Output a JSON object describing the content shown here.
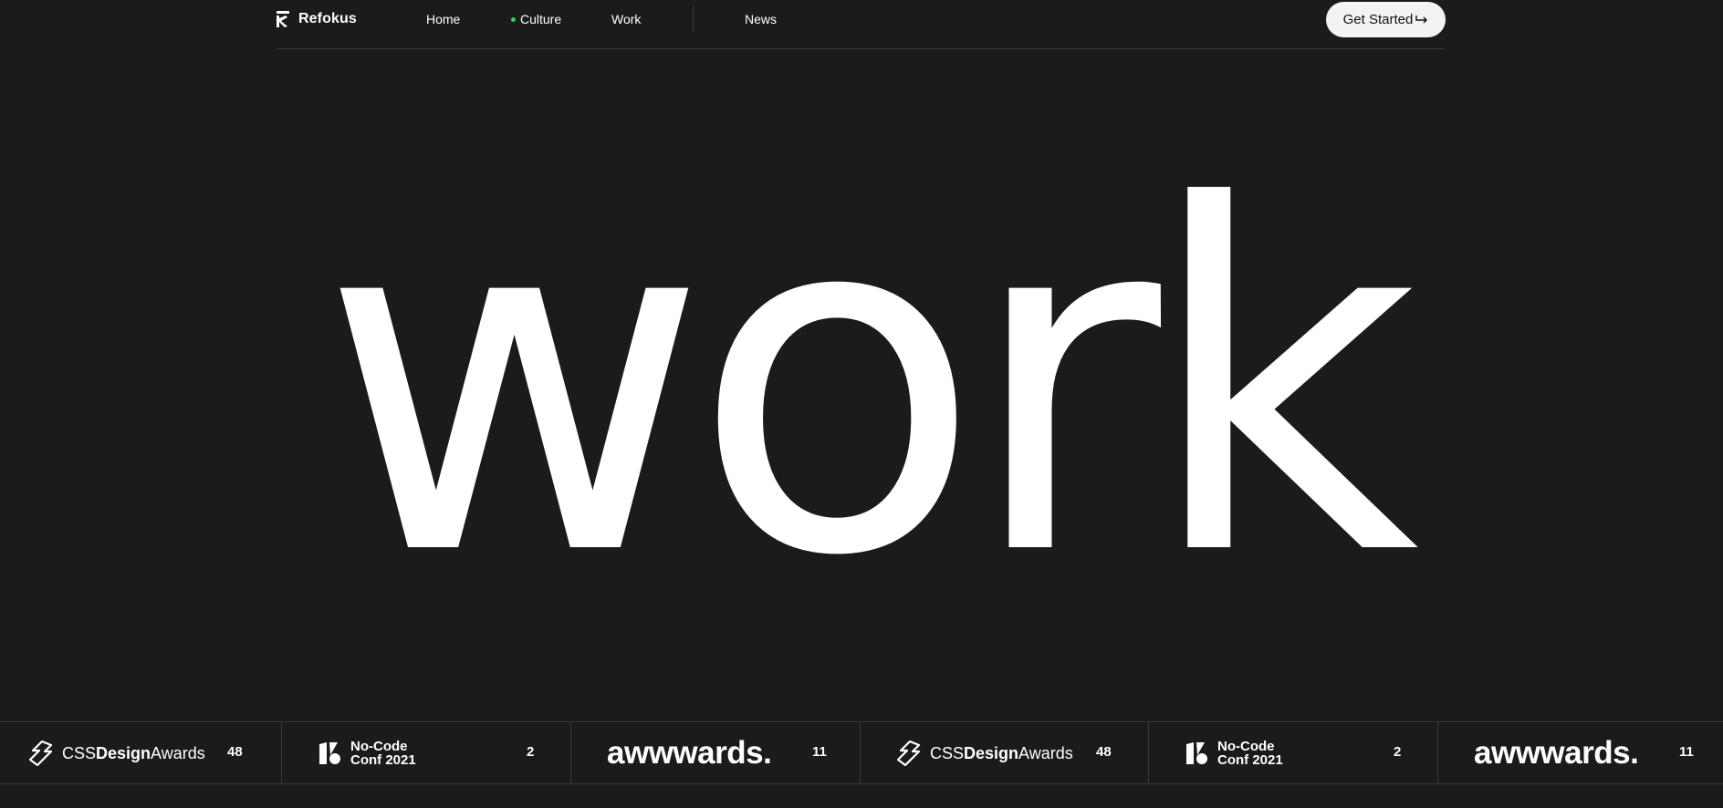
{
  "nav": {
    "brand": "Refokus",
    "links": [
      {
        "label": "Home",
        "active": false
      },
      {
        "label": "Culture",
        "active": true
      },
      {
        "label": "Work",
        "active": false
      },
      {
        "label": "News",
        "active": false
      }
    ],
    "cta_label": "Get Started",
    "cta_icon": "arrow-return-icon"
  },
  "hero": {
    "word": "work"
  },
  "awards": [
    {
      "logo_parts": [
        "CSS",
        "Design",
        "Awards"
      ],
      "count": "48",
      "icon": "css-design-awards-icon"
    },
    {
      "logo_lines": [
        "No-Code",
        "Conf 2021"
      ],
      "count": "2",
      "icon": "no-code-conf-icon"
    },
    {
      "logo": "awwwards.",
      "count": "11"
    },
    {
      "logo_parts": [
        "CSS",
        "Design",
        "Awards"
      ],
      "count": "48",
      "icon": "css-design-awards-icon"
    },
    {
      "logo_lines": [
        "No-Code",
        "Conf 2021"
      ],
      "count": "2",
      "icon": "no-code-conf-icon"
    },
    {
      "logo": "awwwards.",
      "count": "11"
    }
  ],
  "colors": {
    "background": "#1b1b1d",
    "accent_dot": "#2fd35a",
    "cta_bg": "#f3f3f3"
  }
}
